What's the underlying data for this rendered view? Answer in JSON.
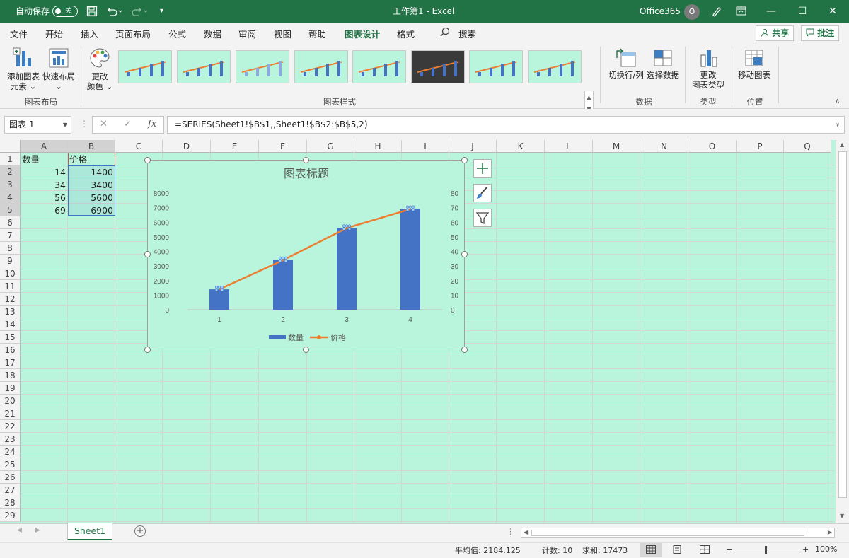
{
  "titlebar": {
    "autosave_label": "自动保存",
    "autosave_state": "关",
    "doc_title": "工作簿1  -  Excel",
    "account": "Office365",
    "avatar_initial": "O"
  },
  "ribbon_tabs": [
    "文件",
    "开始",
    "插入",
    "页面布局",
    "公式",
    "数据",
    "审阅",
    "视图",
    "帮助",
    "图表设计",
    "格式"
  ],
  "search_label": "搜索",
  "share_label": "共享",
  "comments_label": "批注",
  "ribbon": {
    "add_element": {
      "line1": "添加图表",
      "line2": "元素 ⌄"
    },
    "quick_layout": {
      "line1": "快速布局",
      "line2": "⌄"
    },
    "change_colors": {
      "line1": "更改",
      "line2": "颜色 ⌄"
    },
    "group_layout": "图表布局",
    "group_styles": "图表样式",
    "switch_row_col": "切换行/列",
    "select_data": "选择数据",
    "group_data": "数据",
    "change_type": {
      "line1": "更改",
      "line2": "图表类型"
    },
    "group_type": "类型",
    "move_chart": "移动图表",
    "group_location": "位置"
  },
  "formula": {
    "name_box": "图表 1",
    "cancel": "✕",
    "confirm": "✓",
    "fx": "fx",
    "content": "=SERIES(Sheet1!$B$1,,Sheet1!$B$2:$B$5,2)"
  },
  "columns": [
    "A",
    "B",
    "C",
    "D",
    "E",
    "F",
    "G",
    "H",
    "I",
    "J",
    "K",
    "L",
    "M",
    "N",
    "O",
    "P",
    "Q"
  ],
  "rows": [
    "1",
    "2",
    "3",
    "4",
    "5",
    "6",
    "7",
    "8",
    "9",
    "10",
    "11",
    "12",
    "13",
    "14",
    "15",
    "16",
    "17",
    "18",
    "19",
    "20",
    "21",
    "22",
    "23",
    "24",
    "25",
    "26",
    "27",
    "28",
    "29"
  ],
  "cells": {
    "A1": "数量",
    "B1": "价格",
    "A2": "14",
    "B2": "1400",
    "A3": "34",
    "B3": "3400",
    "A4": "56",
    "B4": "5600",
    "A5": "69",
    "B5": "6900"
  },
  "chart_data": {
    "type": "bar",
    "title": "图表标题",
    "categories": [
      "1",
      "2",
      "3",
      "4"
    ],
    "series": [
      {
        "name": "数量",
        "type": "bar",
        "axis": "left",
        "values": [
          1400,
          3400,
          5600,
          6900
        ],
        "color": "#4472c4"
      },
      {
        "name": "价格",
        "type": "line",
        "axis": "right",
        "values": [
          14,
          34,
          56,
          69
        ],
        "color": "#ed7d31"
      }
    ],
    "left_axis": {
      "min": 0,
      "max": 8000,
      "ticks": [
        "0",
        "1000",
        "2000",
        "3000",
        "4000",
        "5000",
        "6000",
        "7000",
        "8000"
      ]
    },
    "right_axis": {
      "min": 0,
      "max": 80,
      "ticks": [
        "0",
        "10",
        "20",
        "30",
        "40",
        "50",
        "60",
        "70",
        "80"
      ]
    },
    "legend_position": "bottom",
    "grid": false
  },
  "sheet_tab": "Sheet1",
  "status": {
    "average": "平均值: 2184.125",
    "count": "计数: 10",
    "sum": "求和: 17473",
    "zoom": "100%"
  },
  "colors": {
    "accent": "#217346",
    "sheet_bg": "#b8f5dc",
    "bar": "#4472c4",
    "line": "#ed7d31"
  }
}
